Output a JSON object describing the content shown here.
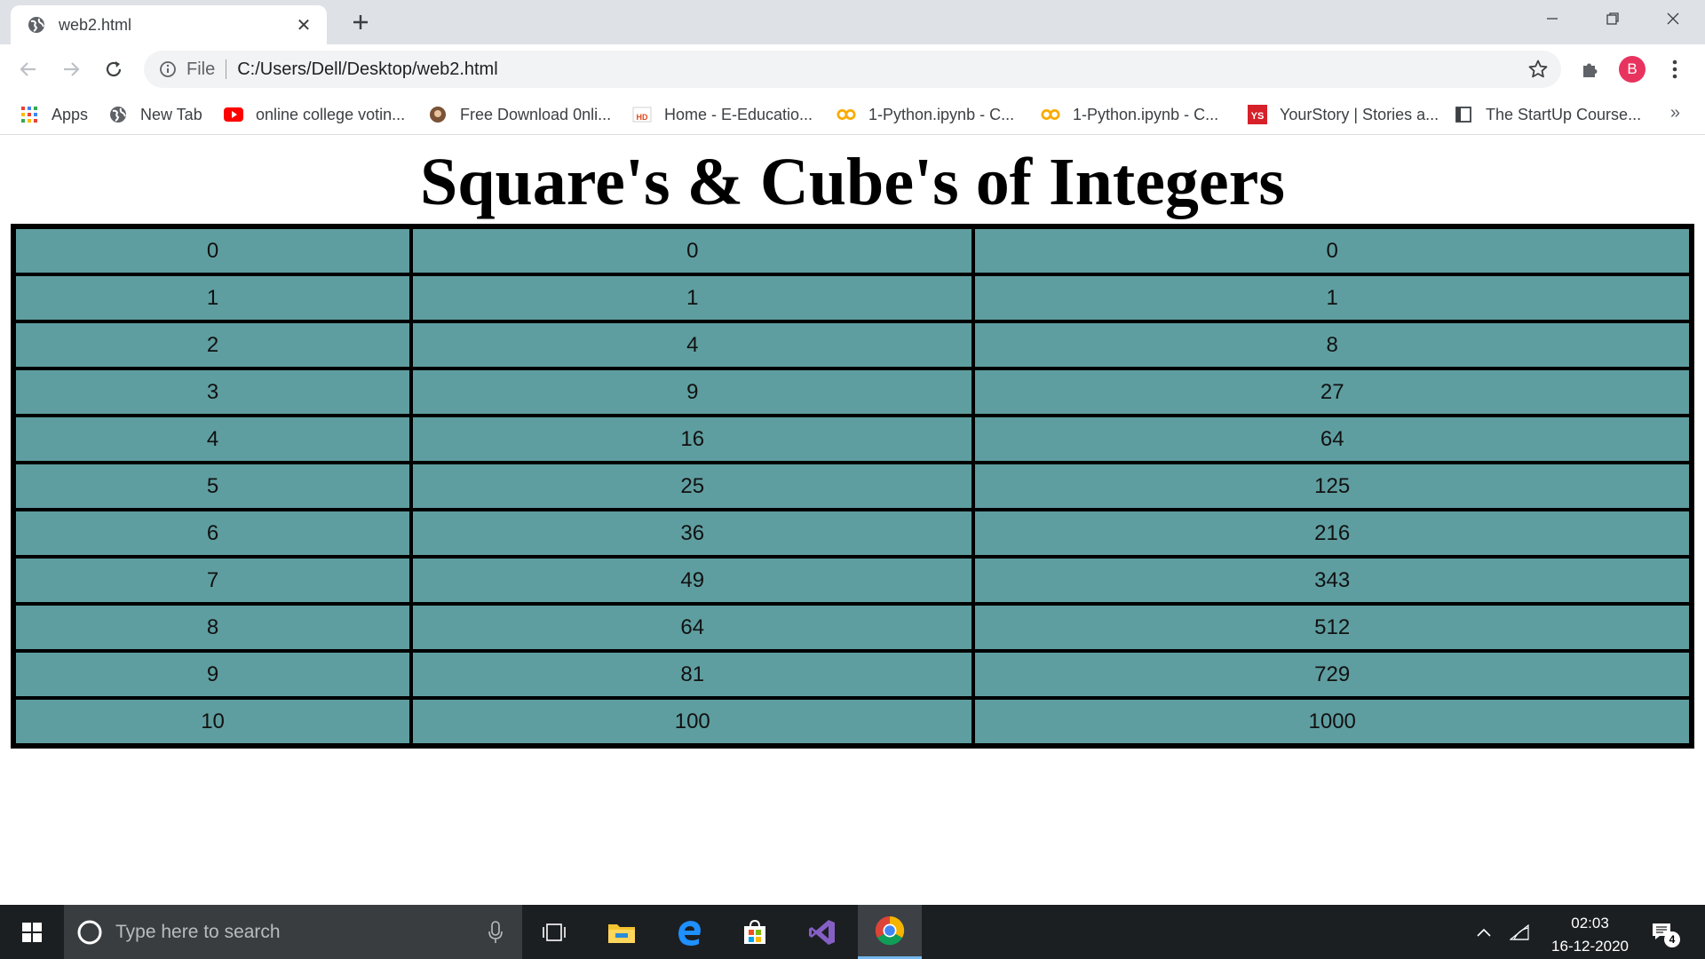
{
  "browser": {
    "tab": {
      "title": "web2.html"
    },
    "omnibox": {
      "scheme": "File",
      "url": "C:/Users/Dell/Desktop/web2.html"
    },
    "profile_initial": "B",
    "bookmarks": [
      {
        "label": "Apps",
        "icon": "apps-grid-icon"
      },
      {
        "label": "New Tab",
        "icon": "globe-icon"
      },
      {
        "label": "online college votin...",
        "icon": "youtube-icon"
      },
      {
        "label": "Free Download 0nli...",
        "icon": "site-favicon-icon"
      },
      {
        "label": "Home - E-Educatio...",
        "icon": "hd-favicon-icon"
      },
      {
        "label": "1-Python.ipynb - C...",
        "icon": "colab-icon"
      },
      {
        "label": "1-Python.ipynb - C...",
        "icon": "colab-icon"
      },
      {
        "label": "YourStory | Stories a...",
        "icon": "yourstory-icon"
      },
      {
        "label": "The StartUp Course...",
        "icon": "page-icon"
      }
    ],
    "bookmarks_more": "»"
  },
  "page": {
    "title": "Square's & Cube's of Integers",
    "rows": [
      [
        "0",
        "0",
        "0"
      ],
      [
        "1",
        "1",
        "1"
      ],
      [
        "2",
        "4",
        "8"
      ],
      [
        "3",
        "9",
        "27"
      ],
      [
        "4",
        "16",
        "64"
      ],
      [
        "5",
        "25",
        "125"
      ],
      [
        "6",
        "36",
        "216"
      ],
      [
        "7",
        "49",
        "343"
      ],
      [
        "8",
        "64",
        "512"
      ],
      [
        "9",
        "81",
        "729"
      ],
      [
        "10",
        "100",
        "1000"
      ]
    ],
    "cell_color": "#5f9ea0"
  },
  "taskbar": {
    "search_placeholder": "Type here to search",
    "time": "02:03",
    "date": "16-12-2020",
    "notification_count": "4"
  }
}
